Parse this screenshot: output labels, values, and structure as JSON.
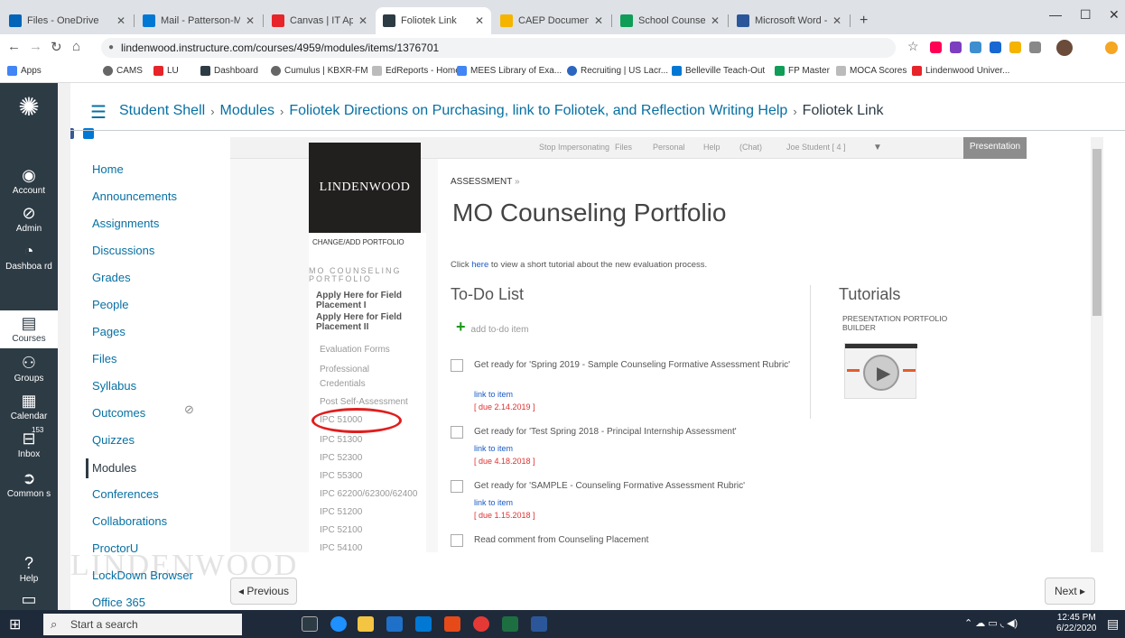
{
  "browser": {
    "tabs": [
      {
        "label": "Files - OneDrive",
        "color": "#0364b8"
      },
      {
        "label": "Mail - Patterson-M",
        "color": "#0078d4"
      },
      {
        "label": "Canvas | IT Applic",
        "color": "#e72429"
      },
      {
        "label": "Foliotek Link",
        "color": "#2d3b45",
        "active": true
      },
      {
        "label": "CAEP Documents",
        "color": "#f4b400"
      },
      {
        "label": "School Counseling",
        "color": "#0f9d58"
      },
      {
        "label": "Microsoft Word -",
        "color": "#2b579a"
      }
    ],
    "new_tab": "+",
    "url": "lindenwood.instructure.com/courses/4959/modules/items/1376701",
    "bookmarks": [
      "Apps",
      "CAMS",
      "LU",
      "Dashboard",
      "Cumulus | KBXR-FM",
      "EdReports - Home",
      "MEES Library of Exa...",
      "Recruiting | US Lacr...",
      "Belleville Teach-Out",
      "FP Master",
      "MOCA Scores",
      "Lindenwood Univer..."
    ]
  },
  "global_nav": [
    {
      "label": "",
      "icon": "logo-icon"
    },
    {
      "label": "Account",
      "icon": "account-icon"
    },
    {
      "label": "Admin",
      "icon": "shield-icon"
    },
    {
      "label": "Dashboa rd",
      "icon": "dashboard-icon"
    },
    {
      "label": "Courses",
      "icon": "book-icon",
      "active": true
    },
    {
      "label": "Groups",
      "icon": "groups-icon"
    },
    {
      "label": "Calendar",
      "icon": "calendar-icon"
    },
    {
      "label": "Inbox",
      "icon": "inbox-icon",
      "badge": "153"
    },
    {
      "label": "Common s",
      "icon": "commons-icon"
    },
    {
      "label": "Help",
      "icon": "help-icon"
    }
  ],
  "breadcrumb": [
    "Student Shell",
    "Modules",
    "Foliotek Directions on Purchasing, link to Foliotek, and Reflection Writing Help",
    "Foliotek Link"
  ],
  "course_nav": [
    "Home",
    "Announcements",
    "Assignments",
    "Discussions",
    "Grades",
    "People",
    "Pages",
    "Files",
    "Syllabus",
    "Outcomes",
    "Quizzes",
    "Modules",
    "Conferences",
    "Collaborations",
    "ProctorU",
    "LockDown Browser",
    "Office 365"
  ],
  "course_nav_active": "Modules",
  "foliotek": {
    "topbar": [
      "Stop Impersonating",
      "Files",
      "Personal",
      "Help",
      "(Chat)",
      "Joe Student [ 4 ]"
    ],
    "presentation_button": "Presentation",
    "logo_text": "LINDENWOOD",
    "change_portfolio": "CHANGE/ADD PORTFOLIO",
    "portfolio_header": "MO COUNSELING PORTFOLIO",
    "portfolio_items_bold": [
      "Apply Here for Field Placement I",
      "Apply Here for Field Placement II"
    ],
    "portfolio_items": [
      "Evaluation Forms",
      "Professional",
      "Credentials",
      "Post Self-Assessment",
      "IPC 51000",
      "IPC 51300",
      "IPC 52300",
      "IPC 55300",
      "IPC 62200/62300/62400",
      "IPC 51200",
      "IPC 52100",
      "IPC 54100"
    ],
    "assessment_label": "ASSESSMENT",
    "assessment_arrow": "»",
    "page_title": "MO Counseling Portfolio",
    "tutorial_prefix": "Click ",
    "tutorial_link": "here",
    "tutorial_suffix": " to view a short tutorial about the new evaluation process.",
    "todo_heading": "To-Do List",
    "add_todo": "add to-do item",
    "todos": [
      {
        "text": "Get ready for 'Spring 2019 - Sample Counseling Formative Assessment Rubric'",
        "link": "link to item",
        "due": "[ due 2.14.2019 ]"
      },
      {
        "text": "Get ready for 'Test Spring 2018 - Principal Internship Assessment'",
        "link": "link to item",
        "due": "[ due 4.18.2018 ]"
      },
      {
        "text": "Get ready for 'SAMPLE - Counseling Formative Assessment Rubric'",
        "link": "link to item",
        "due": "[ due 1.15.2018 ]"
      },
      {
        "text": "Read comment from Counseling Placement",
        "link": "",
        "due": ""
      }
    ],
    "tutorials_heading": "Tutorials",
    "tutorial_item": "PRESENTATION PORTFOLIO BUILDER"
  },
  "watermark": "LINDENWOOD",
  "nav_buttons": {
    "previous": "◂ Previous",
    "next": "Next ▸"
  },
  "taskbar": {
    "search_placeholder": "Start a search",
    "time": "12:45 PM",
    "date": "6/22/2020"
  }
}
